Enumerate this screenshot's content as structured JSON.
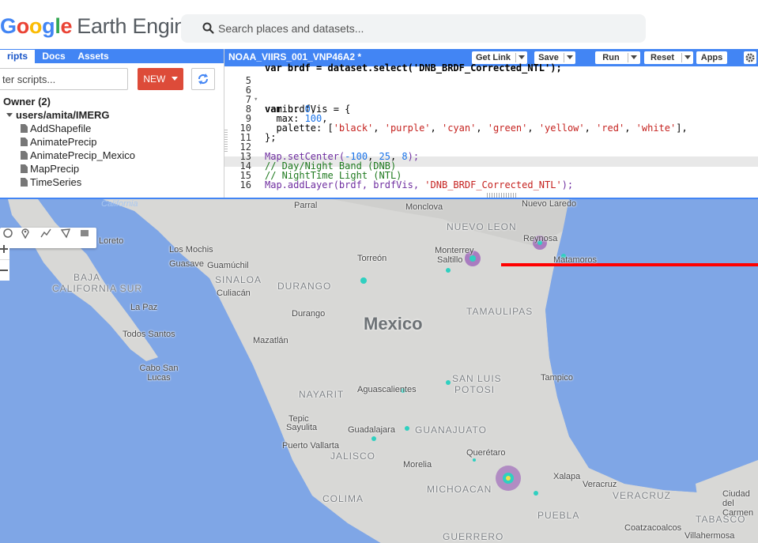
{
  "header": {
    "logo_letters": [
      "G",
      "o",
      "o",
      "g",
      "l",
      "e"
    ],
    "logo_suffix": "Earth Engine",
    "search_placeholder": "Search places and datasets..."
  },
  "left_panel": {
    "tabs": [
      "ripts",
      "Docs",
      "Assets"
    ],
    "filter_placeholder": "ter scripts...",
    "new_button_label": "NEW",
    "tree": [
      {
        "label": "Owner (2)",
        "type": "group"
      },
      {
        "label": "users/amita/IMERG",
        "type": "repo"
      },
      {
        "label": "AddShapefile",
        "type": "file"
      },
      {
        "label": "AnimatePrecip",
        "type": "file"
      },
      {
        "label": "AnimatePrecip_Mexico",
        "type": "file"
      },
      {
        "label": "MapPrecip",
        "type": "file"
      },
      {
        "label": "TimeSeries",
        "type": "file"
      }
    ]
  },
  "editor": {
    "script_title": "NOAA_VIIRS_001_VNP46A2 *",
    "buttons": {
      "get_link": "Get Link",
      "save": "Save",
      "run": "Run",
      "reset": "Reset",
      "apps": "Apps"
    },
    "line_numbers": [
      "5",
      "6",
      "7",
      "8",
      "9",
      "10",
      "11",
      "12",
      "13",
      "14",
      "15",
      "16"
    ],
    "code": {
      "l5": "var brdf = dataset.select('DNB_BRDF_Corrected_NTL');",
      "l6_kw": "var",
      "l6": " brdfVis = {",
      "l7_key": "  min: ",
      "l7_val": "0",
      "l8_key": "  max: ",
      "l8_val": "100",
      "l9_key": "  palette: [",
      "palette": [
        "'black'",
        "'purple'",
        "'cyan'",
        "'green'",
        "'yellow'",
        "'red'",
        "'white'"
      ],
      "l9_end": "],",
      "l10": "};",
      "l12_fn": "Map.setCenter(",
      "l12_a": "-100",
      "l12_b": "25",
      "l12_c": "8",
      "l12_end": ");",
      "l13": "// Day/Night Band (DNB)",
      "l14": "// NightTime Light (NTL)",
      "l15_fn": "Map.addLayer(brdf, brdfVis, ",
      "l15_str": "'DNB_BRDF_Corrected_NTL'",
      "l15_end": ");"
    }
  },
  "map": {
    "country": "Mexico",
    "states": [
      "NUEVO LEON",
      "BAJA",
      "CALIFORNIA SUR",
      "SINALOA",
      "DURANGO",
      "TAMAULIPAS",
      "SAN LUIS",
      "POTOSI",
      "NAYARIT",
      "JALISCO",
      "GUANAJUATO",
      "COLIMA",
      "MICHOACAN",
      "GUERRERO",
      "PUEBLA",
      "VERACRUZ",
      "TABASCO"
    ],
    "cities": [
      "Parral",
      "Monclova",
      "Nuevo Laredo",
      "Reynosa",
      "Monterrey",
      "Saltillo",
      "Matamoros",
      "Torreón",
      "Loreto",
      "Los Mochis",
      "Guasave",
      "Guamúchil",
      "Culiacán",
      "La Paz",
      "Durango",
      "Todos Santos",
      "Mazatlán",
      "Cabo San Lucas",
      "Tampico",
      "Aguascalientes",
      "Tepic",
      "Sayulita",
      "Puerto Vallarta",
      "Guadalajara",
      "Querétaro",
      "Morelia",
      "Xalapa",
      "Veracruz",
      "Ciudad del Carmen",
      "Villahermosa",
      "Coatzacoalcos"
    ],
    "water_label": "California",
    "red_line_color": "#ff0000"
  }
}
